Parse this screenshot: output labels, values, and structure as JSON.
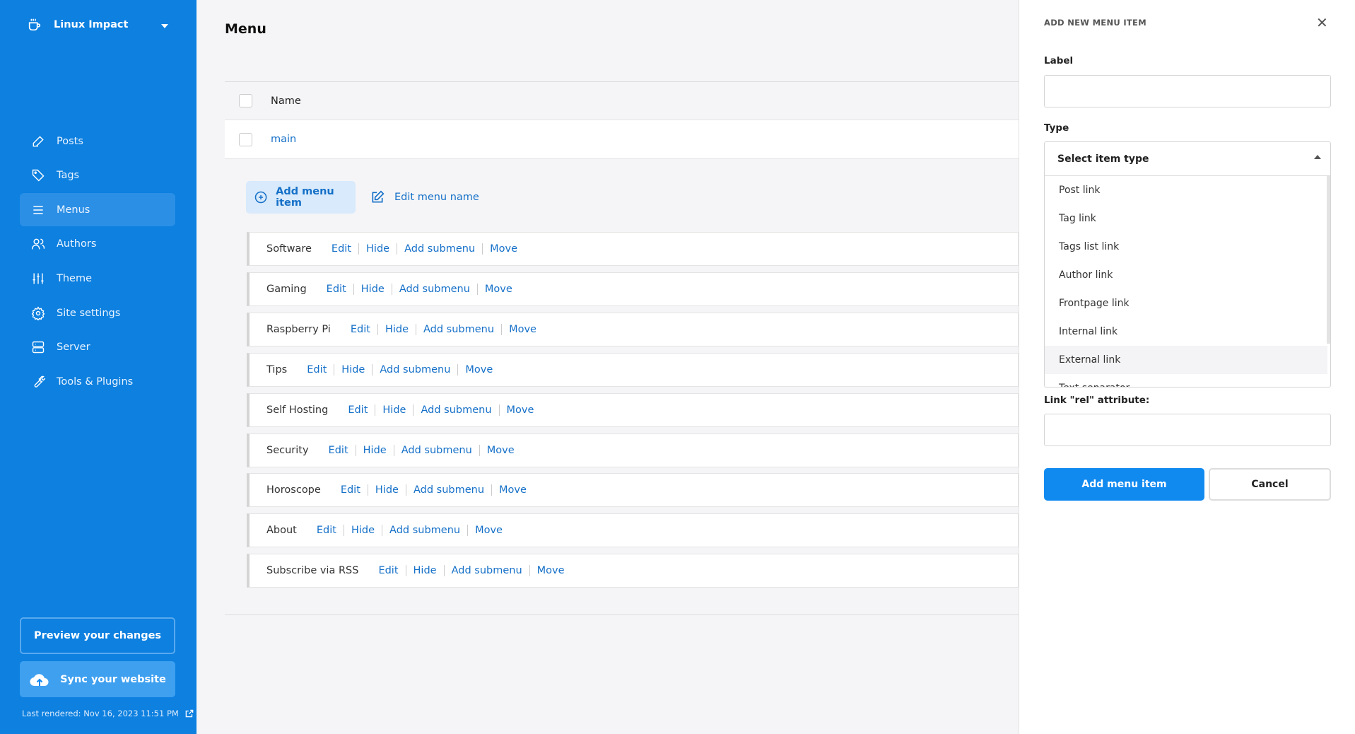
{
  "sidebar": {
    "site_name": "Linux Impact",
    "items": [
      {
        "label": "Posts",
        "icon": "pencil-icon"
      },
      {
        "label": "Tags",
        "icon": "tag-icon"
      },
      {
        "label": "Menus",
        "icon": "menu-icon",
        "active": true
      },
      {
        "label": "Authors",
        "icon": "users-icon"
      },
      {
        "label": "Theme",
        "icon": "sliders-icon"
      },
      {
        "label": "Site settings",
        "icon": "gear-icon"
      },
      {
        "label": "Server",
        "icon": "server-icon"
      },
      {
        "label": "Tools & Plugins",
        "icon": "wrench-icon"
      }
    ],
    "preview_label": "Preview your changes",
    "sync_label": "Sync your website",
    "last_rendered": "Last rendered: Nov 16, 2023 11:51 PM"
  },
  "colors": {
    "sidebar": "#0d80e0",
    "accent": "#118af0",
    "link": "#1570c8"
  },
  "main": {
    "title": "Menu",
    "table_header": "Name",
    "menu_name": "main",
    "add_item_label": "Add menu item",
    "edit_name_label": "Edit menu name",
    "actions": {
      "edit": "Edit",
      "hide": "Hide",
      "add_submenu": "Add submenu",
      "move": "Move"
    },
    "items": [
      "Software",
      "Gaming",
      "Raspberry Pi",
      "Tips",
      "Self Hosting",
      "Security",
      "Horoscope",
      "About",
      "Subscribe via RSS"
    ]
  },
  "panel": {
    "title": "ADD NEW MENU ITEM",
    "label_label": "Label",
    "label_value": "",
    "type_label": "Type",
    "type_placeholder": "Select item type",
    "type_options": [
      "Post link",
      "Tag link",
      "Tags list link",
      "Author link",
      "Frontpage link",
      "Internal link",
      "External link",
      "Text separator"
    ],
    "highlighted_option": "External link",
    "rel_label": "Link \"rel\" attribute:",
    "rel_value": "",
    "submit_label": "Add menu item",
    "cancel_label": "Cancel"
  }
}
